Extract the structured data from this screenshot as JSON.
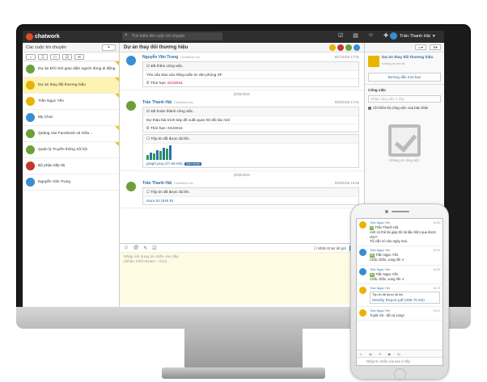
{
  "app": {
    "logo": "chatwork",
    "search_placeholder": "Tìm kiếm tên cuộc trò chuyện",
    "user_name": "Trần Thanh Hải"
  },
  "left": {
    "title": "Các cuộc trò chuyện",
    "new_label": "+",
    "tabs": [
      "⌂",
      "☷",
      "☖",
      "☑",
      "✉"
    ],
    "rooms": [
      {
        "name": "Dự án Đổi mới giao diện người dùng di động",
        "active": false
      },
      {
        "name": "Dự án thay đổi thương hiệu",
        "active": true
      },
      {
        "name": "Trần Ngọc Yến",
        "active": false
      },
      {
        "name": "My Chat",
        "active": false
      },
      {
        "name": "Quảng cáo Facebook và Sólu...",
        "active": false
      },
      {
        "name": "Quản lý Truyền thông Xã hội",
        "active": false
      },
      {
        "name": "Bộ phận tiếp thị",
        "active": false
      },
      {
        "name": "Nguyễn Văn Trung",
        "active": false
      }
    ]
  },
  "chat": {
    "title": "Dự án thay đổi thương hiệu",
    "messages": [
      {
        "name": "Nguyễn Văn Trung",
        "company": "ChatWork Inc",
        "time": "8/17/2016 17:02",
        "task_header": "☑ Đã thêm công việc.",
        "task_body": "Yêu cầu báo cáo hằng tuần từ văn phòng SF",
        "deadline_label": "Thời hạn: ",
        "deadline": "6/1/2016"
      },
      {
        "name": "Trần Thanh Hải",
        "company": "ChatWork Inc",
        "time": "5/29/2016 17:01",
        "task_header": "☑ Đã hoàn thành công việc.",
        "task_body": "Dự thảo bài trình bày để xuất quan hệ đối tác mới",
        "deadline_label": "Thời hạn: ",
        "deadline": "6/1/2016",
        "file_header": "☐ Tệp tin đã được tải lên.",
        "file_link": "graph.png (47.68 KB)",
        "file_badge": "Xem trước"
      },
      {
        "name": "Trần Thanh Hải",
        "company": "ChatWork Inc",
        "time": "5/29/2016 16:58",
        "file_header": "☐ Tệp tin đã được tải lên.",
        "file_link": "store.txt (846 B)"
      }
    ],
    "date_sep_1": "[8/25/2016",
    "date_sep_2": "[8/25/2016",
    "composer": {
      "enter_label": "Nhấn Enter để gửi",
      "send_label": "Gửi",
      "placeholder_1": "Nhập nội dung tin nhắn vào đây",
      "placeholder_2": "(Nhấn Shift+Enter = Gửi)"
    }
  },
  "right": {
    "room_title": "Dự án thay đổi thương hiệu",
    "room_sub": "Không có mô tả",
    "invite_link": "Đường dẫn mời bạn",
    "tasks_label": "Công việc",
    "task_placeholder": "Nhập công việc ở đây",
    "my_tasks": "Chỉ hiển thị công việc của bản thân",
    "empty_text": "Không có công việc"
  },
  "phone": {
    "messages": [
      {
        "name": "Trần Ngọc Yến",
        "time": "15:09",
        "to": "To",
        "to_name": "Trần Thanh Hải",
        "lines": [
          "Anh có thể tải giúp tôi tài liệu hôm qua được chứ?",
          "Tôi cần nó vào ngày mai."
        ]
      },
      {
        "name": "Trần Ngọc Yến",
        "time": "15:09",
        "to": "Re",
        "to_name": "Trần Ngọc Yến",
        "lines": [
          "Chắc chắn, xong rồi! ✔"
        ]
      },
      {
        "name": "Trần Ngọc Yến",
        "time": "15:09",
        "to": "Re",
        "to_name": "Trần Ngọc Yến",
        "lines": [
          "Chắc chắn, xong rồi! ✔"
        ]
      },
      {
        "name": "Trần Ngọc Yến",
        "time": "15:10",
        "file_header": "Tệp tin đã được tải lên.",
        "file_link": "Weekly Report.pdf (308.75 KB)"
      },
      {
        "name": "Trần Ngọc Yến",
        "time": "15:11",
        "lines": [
          "Tuyệt vời - tất cả xong!"
        ]
      }
    ],
    "input_placeholder": "Nhập tin nhắn của bạn ở đây"
  }
}
